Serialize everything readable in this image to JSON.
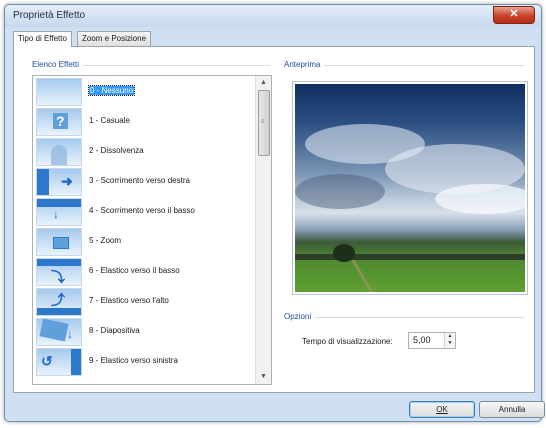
{
  "window": {
    "title": "Proprietà Effetto",
    "close_glyph": "✕"
  },
  "tabs": [
    {
      "label": "Tipo di Effetto",
      "active": true
    },
    {
      "label": "Zoom e Posizione",
      "active": false
    }
  ],
  "effects_group": {
    "label": "Elenco Effetti",
    "items": [
      {
        "label": "0 - Nessuno",
        "selected": true,
        "icon": "blank-thumb"
      },
      {
        "label": "1 - Casuale",
        "selected": false,
        "icon": "question-thumb"
      },
      {
        "label": "2 - Dissolvenza",
        "selected": false,
        "icon": "dissolve-thumb"
      },
      {
        "label": "3 - Scorrimento verso destra",
        "selected": false,
        "icon": "arrow-right-thumb"
      },
      {
        "label": "4 - Scorrimento verso il basso",
        "selected": false,
        "icon": "arrow-down-thumb"
      },
      {
        "label": "5 - Zoom",
        "selected": false,
        "icon": "zoom-thumb"
      },
      {
        "label": "6 - Elastico verso il basso",
        "selected": false,
        "icon": "curve-down-thumb"
      },
      {
        "label": "7 - Elastico verso l'alto",
        "selected": false,
        "icon": "curve-up-thumb"
      },
      {
        "label": "8 - Diapositiva",
        "selected": false,
        "icon": "slide-thumb"
      },
      {
        "label": "9 - Elastico verso sinistra",
        "selected": false,
        "icon": "curve-left-thumb"
      }
    ],
    "scroll_up_glyph": "▲",
    "scroll_down_glyph": "▼"
  },
  "preview_group": {
    "label": "Anteprima",
    "image_description": ""
  },
  "options_group": {
    "label": "Opzioni",
    "display_time_label": "Tempo di visualizzazione:",
    "display_time_value": "5,00",
    "spin_up_glyph": "▲",
    "spin_down_glyph": "▼"
  },
  "buttons": {
    "ok_label": "OK",
    "cancel_label": "Annulla"
  }
}
